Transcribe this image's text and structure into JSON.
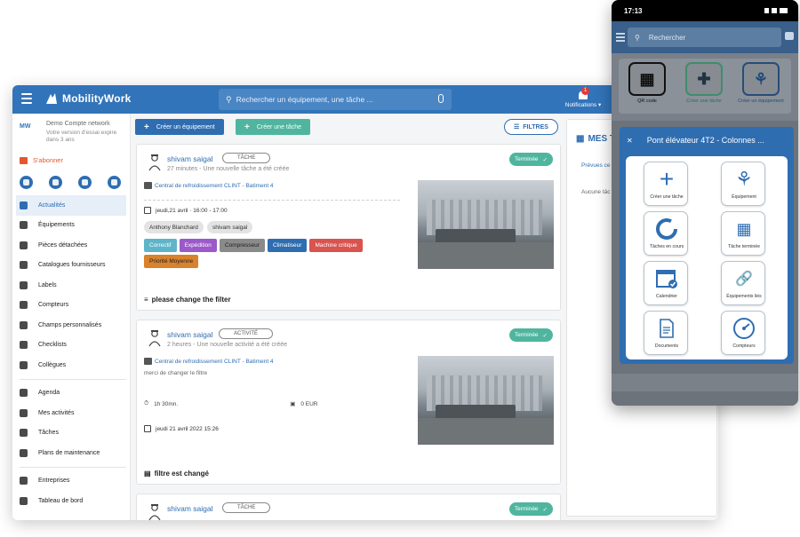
{
  "app": {
    "brand": "MobilityWork",
    "search_placeholder": "Rechercher un équipement, une tâche ...",
    "notifications_label": "Notifications",
    "notifications_count": "1"
  },
  "account": {
    "logo": "MW",
    "name": "Demo Compte network",
    "trial": "Votre version d'essai expire dans 3 ans",
    "subscribe": "S'abonner"
  },
  "sidebar": {
    "items": [
      {
        "label": "Actualités",
        "icon": "news-icon",
        "active": true
      },
      {
        "label": "Équipements",
        "icon": "equipment-icon"
      },
      {
        "label": "Pièces détachées",
        "icon": "parts-icon"
      },
      {
        "label": "Catalogues fournisseurs",
        "icon": "catalog-icon"
      },
      {
        "label": "Labels",
        "icon": "label-icon"
      },
      {
        "label": "Compteurs",
        "icon": "counter-icon"
      },
      {
        "label": "Champs personnalisés",
        "icon": "custom-fields-icon"
      },
      {
        "label": "Checklists",
        "icon": "checklist-icon"
      },
      {
        "label": "Collègues",
        "icon": "colleagues-icon"
      },
      {
        "label": "Agenda",
        "icon": "agenda-icon"
      },
      {
        "label": "Mes activités",
        "icon": "activities-icon"
      },
      {
        "label": "Tâches",
        "icon": "tasks-icon"
      },
      {
        "label": "Plans de maintenance",
        "icon": "maintenance-icon"
      },
      {
        "label": "Entreprises",
        "icon": "companies-icon"
      },
      {
        "label": "Tableau de bord",
        "icon": "dashboard-icon"
      }
    ]
  },
  "toolbar": {
    "create_equipment": "Créer un équipement",
    "create_task": "Créer une tâche",
    "filters": "FILTRES"
  },
  "feed": [
    {
      "user": "shivam saigal",
      "type": "TÂCHE",
      "meta": "27 minutes - Une nouvelle tâche a été créée",
      "status": "Terminée",
      "equipment": "Central de refroidissement CLINT - Batiment 4",
      "date": "jeudi,21 avril · 16:00 - 17:00",
      "people": [
        "Anthony Blanchard",
        "shivam saigal"
      ],
      "tags": [
        {
          "label": "Correctif",
          "color": "#5fb4c8"
        },
        {
          "label": "Expédition",
          "color": "#9b59c9"
        },
        {
          "label": "Compresseur",
          "color": "#8a8a8a"
        },
        {
          "label": "Climatiseur",
          "color": "#2f6db1"
        },
        {
          "label": "Machine critique",
          "color": "#d9534f"
        },
        {
          "label": "Priorité Moyenne",
          "color": "#d9822b"
        }
      ],
      "comment": "please change the filter"
    },
    {
      "user": "shivam saigal",
      "type": "ACTIVITÉ",
      "meta": "2 heures - Une nouvelle activité a été créée",
      "status": "Terminée",
      "equipment": "Central de refroidissement CLINT - Batiment 4",
      "note": "merci de changer le filtre",
      "duration": "1h 30mn.",
      "cost": "0 EUR",
      "date": "jeudi 21 avril 2022 15:26",
      "comment": "filtre est changé"
    },
    {
      "user": "shivam saigal",
      "type": "TÂCHE",
      "status": "Terminée"
    }
  ],
  "right_panel": {
    "title": "MES T",
    "subtitle": "Prévues ce",
    "empty": "Aucune tâc"
  },
  "phone": {
    "time": "17:13",
    "search_placeholder": "Rechercher",
    "quick": [
      {
        "label": "QR code",
        "icon": "qr-code-icon"
      },
      {
        "label": "Créer une tâche",
        "icon": "tools-icon"
      },
      {
        "label": "Créer un équipement",
        "icon": "equipment-icon"
      }
    ],
    "modal_title": "Pont élévateur 4T2 - Colonnes ...",
    "tiles": [
      {
        "label": "Créer une tâche",
        "icon": "plus-icon"
      },
      {
        "label": "Équipement",
        "icon": "equipment-icon"
      },
      {
        "label": "Tâches en cours",
        "icon": "progress-ring-icon"
      },
      {
        "label": "Tâche terminée",
        "icon": "grid-icon"
      },
      {
        "label": "Calendrier",
        "icon": "calendar-check-icon"
      },
      {
        "label": "Équipements liés",
        "icon": "link-icon"
      },
      {
        "label": "Documents",
        "icon": "document-icon"
      },
      {
        "label": "Compteurs",
        "icon": "gauge-icon"
      }
    ]
  }
}
